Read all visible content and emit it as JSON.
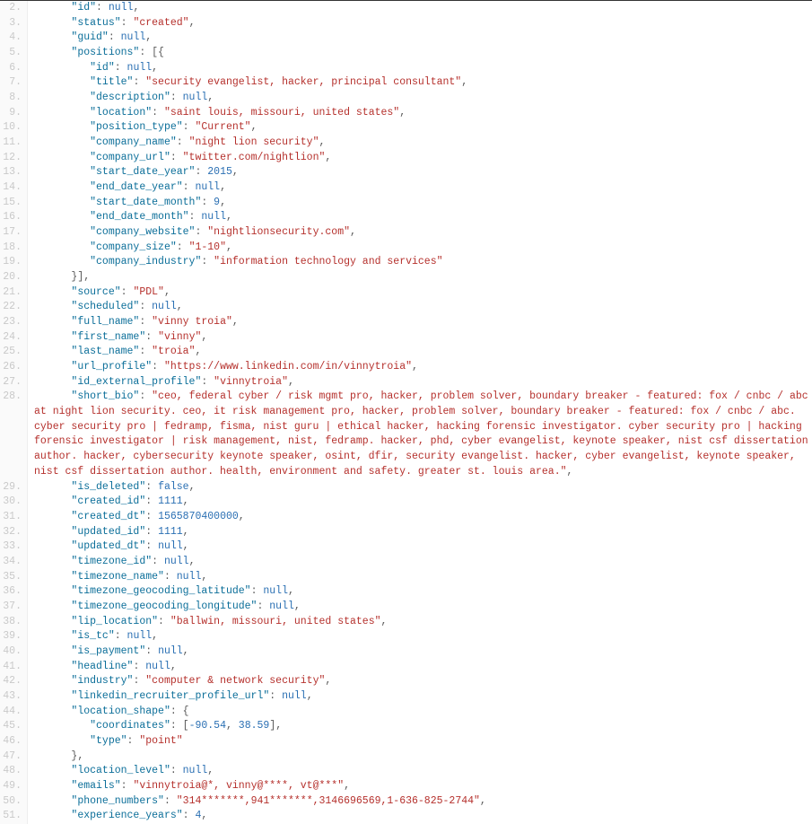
{
  "lines": [
    {
      "n": 2,
      "indent": 2,
      "key": "id",
      "value": {
        "type": "null"
      },
      "trail": ","
    },
    {
      "n": 3,
      "indent": 2,
      "key": "status",
      "value": {
        "type": "str",
        "v": "created"
      },
      "trail": ","
    },
    {
      "n": 4,
      "indent": 2,
      "key": "guid",
      "value": {
        "type": "null"
      },
      "trail": ","
    },
    {
      "n": 5,
      "indent": 2,
      "key": "positions",
      "value": {
        "type": "raw",
        "v": "[{"
      },
      "trail": ""
    },
    {
      "n": 6,
      "indent": 3,
      "key": "id",
      "value": {
        "type": "null"
      },
      "trail": ","
    },
    {
      "n": 7,
      "indent": 3,
      "key": "title",
      "value": {
        "type": "str",
        "v": "security evangelist, hacker, principal consultant"
      },
      "trail": ","
    },
    {
      "n": 8,
      "indent": 3,
      "key": "description",
      "value": {
        "type": "null"
      },
      "trail": ","
    },
    {
      "n": 9,
      "indent": 3,
      "key": "location",
      "value": {
        "type": "str",
        "v": "saint louis, missouri, united states"
      },
      "trail": ","
    },
    {
      "n": 10,
      "indent": 3,
      "key": "position_type",
      "value": {
        "type": "str",
        "v": "Current"
      },
      "trail": ","
    },
    {
      "n": 11,
      "indent": 3,
      "key": "company_name",
      "value": {
        "type": "str",
        "v": "night lion security"
      },
      "trail": ","
    },
    {
      "n": 12,
      "indent": 3,
      "key": "company_url",
      "value": {
        "type": "str",
        "v": "twitter.com/nightlion"
      },
      "trail": ","
    },
    {
      "n": 13,
      "indent": 3,
      "key": "start_date_year",
      "value": {
        "type": "num",
        "v": "2015"
      },
      "trail": ","
    },
    {
      "n": 14,
      "indent": 3,
      "key": "end_date_year",
      "value": {
        "type": "null"
      },
      "trail": ","
    },
    {
      "n": 15,
      "indent": 3,
      "key": "start_date_month",
      "value": {
        "type": "num",
        "v": "9"
      },
      "trail": ","
    },
    {
      "n": 16,
      "indent": 3,
      "key": "end_date_month",
      "value": {
        "type": "null"
      },
      "trail": ","
    },
    {
      "n": 17,
      "indent": 3,
      "key": "company_website",
      "value": {
        "type": "str",
        "v": "nightlionsecurity.com"
      },
      "trail": ","
    },
    {
      "n": 18,
      "indent": 3,
      "key": "company_size",
      "value": {
        "type": "str",
        "v": "1-10"
      },
      "trail": ","
    },
    {
      "n": 19,
      "indent": 3,
      "key": "company_industry",
      "value": {
        "type": "str",
        "v": "information technology and services"
      },
      "trail": ""
    },
    {
      "n": 20,
      "indent": 2,
      "rawline": "}],"
    },
    {
      "n": 21,
      "indent": 2,
      "key": "source",
      "value": {
        "type": "str",
        "v": "PDL"
      },
      "trail": ","
    },
    {
      "n": 22,
      "indent": 2,
      "key": "scheduled",
      "value": {
        "type": "null"
      },
      "trail": ","
    },
    {
      "n": 23,
      "indent": 2,
      "key": "full_name",
      "value": {
        "type": "str",
        "v": "vinny troia"
      },
      "trail": ","
    },
    {
      "n": 24,
      "indent": 2,
      "key": "first_name",
      "value": {
        "type": "str",
        "v": "vinny"
      },
      "trail": ","
    },
    {
      "n": 25,
      "indent": 2,
      "key": "last_name",
      "value": {
        "type": "str",
        "v": "troia"
      },
      "trail": ","
    },
    {
      "n": 26,
      "indent": 2,
      "key": "url_profile",
      "value": {
        "type": "str",
        "v": "https://www.linkedin.com/in/vinnytroia"
      },
      "trail": ","
    },
    {
      "n": 27,
      "indent": 2,
      "key": "id_external_profile",
      "value": {
        "type": "str",
        "v": "vinnytroia"
      },
      "trail": ","
    },
    {
      "n": 28,
      "indent": 2,
      "key": "short_bio",
      "value": {
        "type": "str",
        "v": "ceo, federal cyber / risk mgmt pro, hacker, problem solver, boundary breaker - featured: fox / cnbc / abc at night lion security. ceo, it risk management pro, hacker, problem solver, boundary breaker - featured: fox / cnbc / abc. cyber security pro | fedramp, fisma, nist guru | ethical hacker, hacking forensic investigator. cyber security pro | hacking forensic investigator | risk management, nist, fedramp. hacker, phd, cyber evangelist, keynote speaker, nist csf dissertation author. hacker, cybersecurity keynote speaker, osint, dfir, security evangelist. hacker, cyber evangelist, keynote speaker, nist csf dissertation author. health, environment and safety. greater st. louis area."
      },
      "trail": ","
    },
    {
      "n": 29,
      "indent": 2,
      "key": "is_deleted",
      "value": {
        "type": "bool",
        "v": "false"
      },
      "trail": ","
    },
    {
      "n": 30,
      "indent": 2,
      "key": "created_id",
      "value": {
        "type": "num",
        "v": "1111"
      },
      "trail": ","
    },
    {
      "n": 31,
      "indent": 2,
      "key": "created_dt",
      "value": {
        "type": "num",
        "v": "1565870400000"
      },
      "trail": ","
    },
    {
      "n": 32,
      "indent": 2,
      "key": "updated_id",
      "value": {
        "type": "num",
        "v": "1111"
      },
      "trail": ","
    },
    {
      "n": 33,
      "indent": 2,
      "key": "updated_dt",
      "value": {
        "type": "null"
      },
      "trail": ","
    },
    {
      "n": 34,
      "indent": 2,
      "key": "timezone_id",
      "value": {
        "type": "null"
      },
      "trail": ","
    },
    {
      "n": 35,
      "indent": 2,
      "key": "timezone_name",
      "value": {
        "type": "null"
      },
      "trail": ","
    },
    {
      "n": 36,
      "indent": 2,
      "key": "timezone_geocoding_latitude",
      "value": {
        "type": "null"
      },
      "trail": ","
    },
    {
      "n": 37,
      "indent": 2,
      "key": "timezone_geocoding_longitude",
      "value": {
        "type": "null"
      },
      "trail": ","
    },
    {
      "n": 38,
      "indent": 2,
      "key": "lip_location",
      "value": {
        "type": "str",
        "v": "ballwin, missouri, united states"
      },
      "trail": ","
    },
    {
      "n": 39,
      "indent": 2,
      "key": "is_tc",
      "value": {
        "type": "null"
      },
      "trail": ","
    },
    {
      "n": 40,
      "indent": 2,
      "key": "is_payment",
      "value": {
        "type": "null"
      },
      "trail": ","
    },
    {
      "n": 41,
      "indent": 2,
      "key": "headline",
      "value": {
        "type": "null"
      },
      "trail": ","
    },
    {
      "n": 42,
      "indent": 2,
      "key": "industry",
      "value": {
        "type": "str",
        "v": "computer & network security"
      },
      "trail": ","
    },
    {
      "n": 43,
      "indent": 2,
      "key": "linkedin_recruiter_profile_url",
      "value": {
        "type": "null"
      },
      "trail": ","
    },
    {
      "n": 44,
      "indent": 2,
      "key": "location_shape",
      "value": {
        "type": "raw",
        "v": "{"
      },
      "trail": ""
    },
    {
      "n": 45,
      "indent": 3,
      "key": "coordinates",
      "value": {
        "type": "coords",
        "a": "-90.54",
        "b": "38.59"
      },
      "trail": ","
    },
    {
      "n": 46,
      "indent": 3,
      "key": "type",
      "value": {
        "type": "str",
        "v": "point"
      },
      "trail": ""
    },
    {
      "n": 47,
      "indent": 2,
      "rawline": "},"
    },
    {
      "n": 48,
      "indent": 2,
      "key": "location_level",
      "value": {
        "type": "null"
      },
      "trail": ","
    },
    {
      "n": 49,
      "indent": 2,
      "key": "emails",
      "value": {
        "type": "str",
        "v": "vinnytroia@*, vinny@****, vt@***"
      },
      "trail": ","
    },
    {
      "n": 50,
      "indent": 2,
      "key": "phone_numbers",
      "value": {
        "type": "str",
        "v": "314*******,941*******,3146696569,1-636-825-2744"
      },
      "trail": ","
    },
    {
      "n": 51,
      "indent": 2,
      "key": "experience_years",
      "value": {
        "type": "num",
        "v": "4"
      },
      "trail": ","
    }
  ]
}
